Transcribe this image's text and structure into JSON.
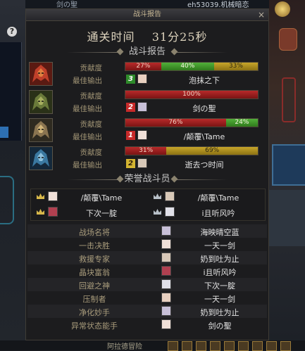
{
  "background": {
    "top_tab_left": "剑の聖",
    "top_tab_right": "eh53039.机械暗恋",
    "bottom_label": "阿拉德冒险"
  },
  "window": {
    "title": "战斗报告",
    "close_glyph": "×"
  },
  "clear_time": {
    "text": "通关时间    31分25秒"
  },
  "battle_report": {
    "header": "战斗报告",
    "contribution_label": "贡献度",
    "best_output_label": "最佳输出",
    "players": [
      {
        "portrait": "crimson-helm",
        "segments": [
          {
            "color": "red",
            "percent": 27,
            "label": "27%"
          },
          {
            "color": "green",
            "percent": 40,
            "label": "40%"
          },
          {
            "color": "gold",
            "percent": 33,
            "label": "33%"
          }
        ],
        "best_rank": "3",
        "best_rank_color": "green",
        "best_name": "泡抹之下"
      },
      {
        "portrait": "olive-helm",
        "segments": [
          {
            "color": "red",
            "percent": 100,
            "label": "100%"
          }
        ],
        "best_rank": "2",
        "best_rank_color": "red",
        "best_name": "剑の聖"
      },
      {
        "portrait": "bronze-helm",
        "segments": [
          {
            "color": "red",
            "percent": 76,
            "label": "76%"
          },
          {
            "color": "green",
            "percent": 24,
            "label": "24%"
          }
        ],
        "best_rank": "1",
        "best_rank_color": "red",
        "best_name": "/颠覆\\Tame"
      },
      {
        "portrait": "azure-helm",
        "segments": [
          {
            "color": "red",
            "percent": 31,
            "label": "31%"
          },
          {
            "color": "gold",
            "percent": 69,
            "label": "69%"
          }
        ],
        "best_rank": "2",
        "best_rank_color": "gold",
        "best_name": "逝去つ时间"
      }
    ]
  },
  "honor": {
    "header": "荣誉战斗员",
    "cells": [
      {
        "name": "/颠覆\\Tame",
        "crown": "gold"
      },
      {
        "name": "/颠覆\\Tame",
        "crown": "silver"
      },
      {
        "name": "下次一腚",
        "crown": "gold"
      },
      {
        "name": "i且听风吟",
        "crown": "silver"
      }
    ]
  },
  "awards": [
    {
      "title": "战场名将",
      "name": "海映晴空蓝"
    },
    {
      "title": "一击决胜",
      "name": "一天一剑"
    },
    {
      "title": "救援专家",
      "name": "奶到吐为止"
    },
    {
      "title": "晶块富翁",
      "name": "i且听风吟"
    },
    {
      "title": "回避之神",
      "name": "下次一腚"
    },
    {
      "title": "压制者",
      "name": "一天一剑"
    },
    {
      "title": "净化妙手",
      "name": "奶到吐为止"
    },
    {
      "title": "异常状态能手",
      "name": "剑の聖"
    }
  ],
  "colors": {
    "bar_red": "#b82a2a",
    "bar_green": "#52b03a",
    "bar_gold": "#c8a62a",
    "window_bg": "#1c1c1e",
    "label_text": "#a39676"
  }
}
